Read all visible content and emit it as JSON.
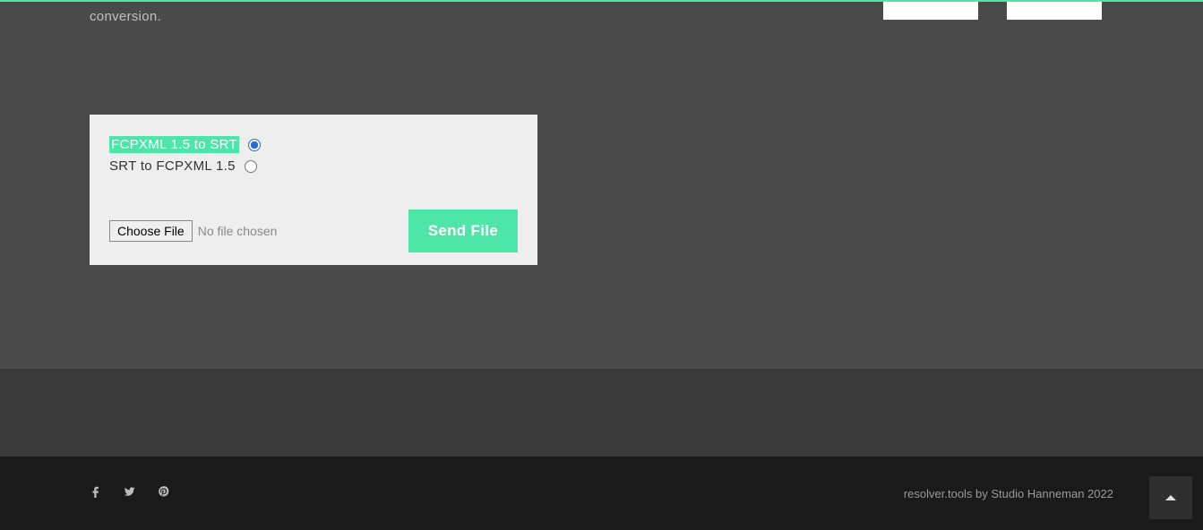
{
  "fragment_text": "conversion.",
  "form": {
    "option1": "FCPXML 1.5 to SRT",
    "option2": "SRT to FCPXML 1.5",
    "choose_file_label": "Choose File",
    "file_status": "No file chosen",
    "send_label": "Send File"
  },
  "footer": {
    "credit": "resolver.tools by Studio Hanneman 2022"
  }
}
